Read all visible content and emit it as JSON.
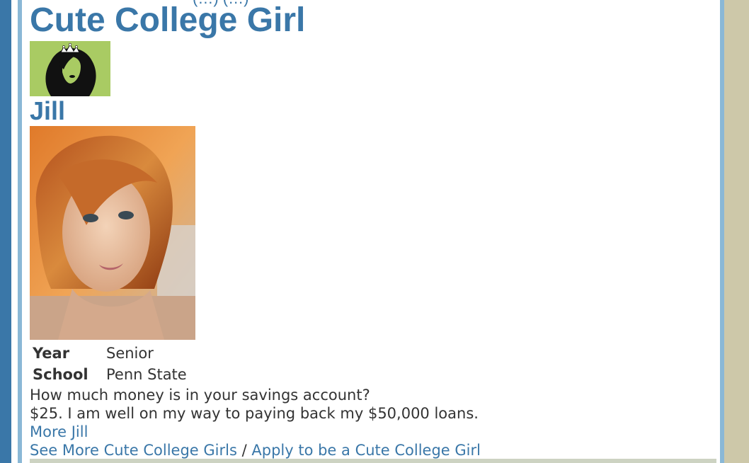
{
  "page": {
    "top_fragment": "(…)            (…)",
    "feature_title": "Cute College Girl"
  },
  "profile": {
    "name": "Jill",
    "fields": [
      {
        "label": "Year",
        "value": "Senior"
      },
      {
        "label": "School",
        "value": "Penn State"
      }
    ],
    "question": "How much money is in your savings account?",
    "answer": "$25. I am well on my way to paying back my $50,000 loans.",
    "more_link": "More Jill"
  },
  "footer": {
    "see_more_link": "See More Cute College Girls",
    "separator": " / ",
    "apply_link": "Apply to be a Cute College Girl"
  },
  "icons": {
    "logo": "tiara-girl-silhouette-icon"
  },
  "colors": {
    "accent": "#3a77a8",
    "frame": "#8ab8d6",
    "page_bg": "#cdc8a9",
    "logo_bg": "#a9cb63",
    "text": "#333333"
  }
}
